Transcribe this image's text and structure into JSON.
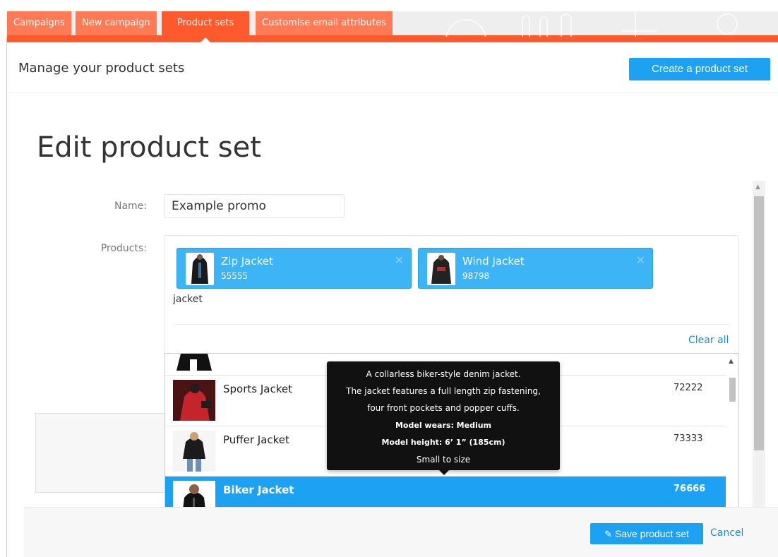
{
  "tabs": [
    {
      "label": "Campaigns"
    },
    {
      "label": "New campaign"
    },
    {
      "label": "Product sets"
    },
    {
      "label": "Customise email attributes"
    }
  ],
  "header": {
    "title": "Manage your product sets",
    "create_button": "Create a product set"
  },
  "form": {
    "title": "Edit product set",
    "name_label": "Name:",
    "name_value": "Example promo",
    "products_label": "Products:",
    "search_text": "jacket",
    "clear_all": "Clear all"
  },
  "selected_products": [
    {
      "name": "Zip Jacket",
      "id": "55555"
    },
    {
      "name": "Wind Jacket",
      "id": "98798"
    }
  ],
  "results": [
    {
      "name": "",
      "id": ""
    },
    {
      "name": "Sports Jacket",
      "id": "72222"
    },
    {
      "name": "Puffer Jacket",
      "id": "73333"
    },
    {
      "name": "Biker Jacket",
      "id": "76666",
      "selected": true
    }
  ],
  "tooltip": {
    "line1": "A collarless biker-style denim jacket.",
    "line2": "The jacket features a full length zip fastening,",
    "line3": "four front pockets and popper cuffs.",
    "line4": "Model wears: Medium",
    "line5": "Model height: 6’ 1” (185cm)",
    "line6": "Small to size"
  },
  "footer": {
    "save_button": "Save product set",
    "cancel": "Cancel"
  },
  "colors": {
    "accent": "#1da1f2",
    "brand_orange": "#ff5a2e",
    "tab_orange": "#ff7a55"
  }
}
